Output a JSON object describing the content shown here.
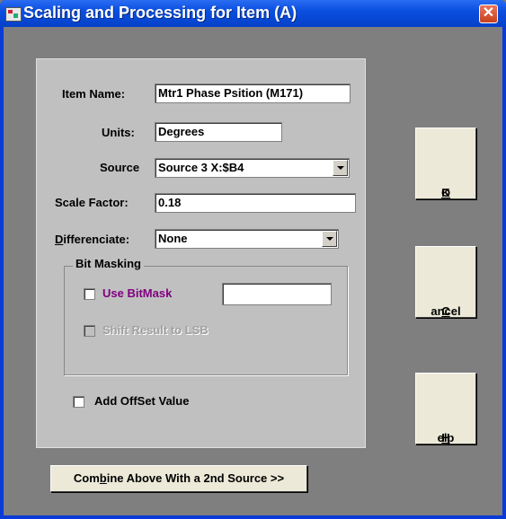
{
  "window": {
    "title": "Scaling and Processing for Item (A)",
    "close_label": "✕"
  },
  "form": {
    "item_name_label": "Item Name:",
    "item_name_value": "Mtr1 Phase Psition (M171)",
    "units_label": "Units:",
    "units_value": "Degrees",
    "source_label": "Source",
    "source_value": "Source 3  X:$B4",
    "scale_label": "Scale Factor:",
    "scale_value": "0.18",
    "diff_label_first": "D",
    "diff_label_rest": "ifferenciate:",
    "diff_value": "None"
  },
  "bitmask": {
    "group_label": "Bit Masking",
    "use_label": "Use BitMask",
    "use_value": "",
    "shift_label": "Shift Result to LSB"
  },
  "offset": {
    "label": "Add OffSet Value"
  },
  "buttons": {
    "ok_first": "O",
    "ok_rest": "K",
    "cancel_first": "C",
    "cancel_rest": "ancel",
    "help_first": "H",
    "help_rest": "elp",
    "combine_pre": "Com",
    "combine_ul": "b",
    "combine_post": "ine Above With a 2nd Source >>"
  },
  "colors": {
    "titlebar": "#0a4fe0",
    "panel": "#c0c0c0",
    "accent_purple": "#800080"
  }
}
